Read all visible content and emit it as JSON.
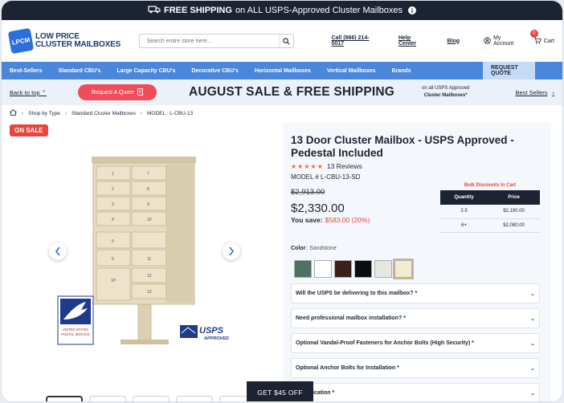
{
  "topbar": {
    "bold": "FREE SHIPPING",
    "text": "on ALL USPS-Approved Cluster Mailboxes",
    "truck_icon": "truck-icon",
    "info": "i"
  },
  "header": {
    "logo_mark": "LPCM",
    "logo_line1": "LOW PRICE",
    "logo_line2": "CLUSTER MAILBOXES",
    "search_placeholder": "Search entire store here...",
    "phone": "Call (866) 214-0017",
    "help": "Help Center",
    "blog": "Blog",
    "account": "My Account",
    "cart": "Cart",
    "cart_count": "0"
  },
  "nav": {
    "items": [
      "Best-Sellers",
      "Standard CBU's",
      "Large Capacity CBU's",
      "Decorative CBU's",
      "Horizontal Mailboxes",
      "Vertical Mailboxes",
      "Brands"
    ],
    "quote": "REQUEST QUOTE"
  },
  "promo": {
    "back": "Back to top",
    "request": "Request A Quote",
    "title": "AUGUST SALE & FREE SHIPPING",
    "sub1": "on all USPS Approved",
    "sub2": "Cluster Mailboxes*",
    "best": "Best Sellers"
  },
  "breadcrumb": {
    "items": [
      "Shop by Type",
      "Standard Cluster Mailboxes",
      "MODEL : L-CBU-13"
    ]
  },
  "gallery": {
    "badge": "ON SALE",
    "offer": "GET $45 OFF",
    "usps_seal_line1": "UNITED STATES",
    "usps_seal_line2": "POSTAL SERVICE",
    "usps_logo": "USPS",
    "usps_logo_sub": "APPROVED",
    "door_numbers": [
      "1",
      "2",
      "3",
      "4",
      "5",
      "6",
      "7",
      "8",
      "9",
      "10",
      "11",
      "12",
      "13"
    ],
    "door_label_1p": "1P"
  },
  "product": {
    "title": "13 Door Cluster Mailbox - USPS Approved - Pedestal Included",
    "rating": 4.5,
    "reviews": "13 Reviews",
    "model": "MODEL # L-CBU-13-SD",
    "old_price": "$2,913.00",
    "price": "$2,330.00",
    "save_label": "You save:",
    "save_value": "$583.00 (20%)",
    "color_label": "Color",
    "color_value": "Sandstone",
    "swatches": [
      "#4e7261",
      "#ffffff",
      "#3c1e1a",
      "#0d0d0d",
      "#e6e8e0",
      "#f3ead2"
    ]
  },
  "bulk": {
    "title": "Bulk Discounts In Cart",
    "headers": [
      "Quantity",
      "Price"
    ],
    "rows": [
      [
        "2-5",
        "$2,190.00"
      ],
      [
        "6+",
        "$2,080.00"
      ]
    ]
  },
  "options": [
    "Will the USPS be delivering to this mailbox? *",
    "Need professional mailbox installation? *",
    "Optional Vandal-Proof Fasteners for Anchor Bolts (High Security) *",
    "Optional Anchor Bolts for Installation *",
    "Identification *"
  ],
  "colors": {
    "dark": "#1c2433",
    "nav": "#4a86d9",
    "accent": "#ef4d5a",
    "sale": "#e8453c"
  }
}
